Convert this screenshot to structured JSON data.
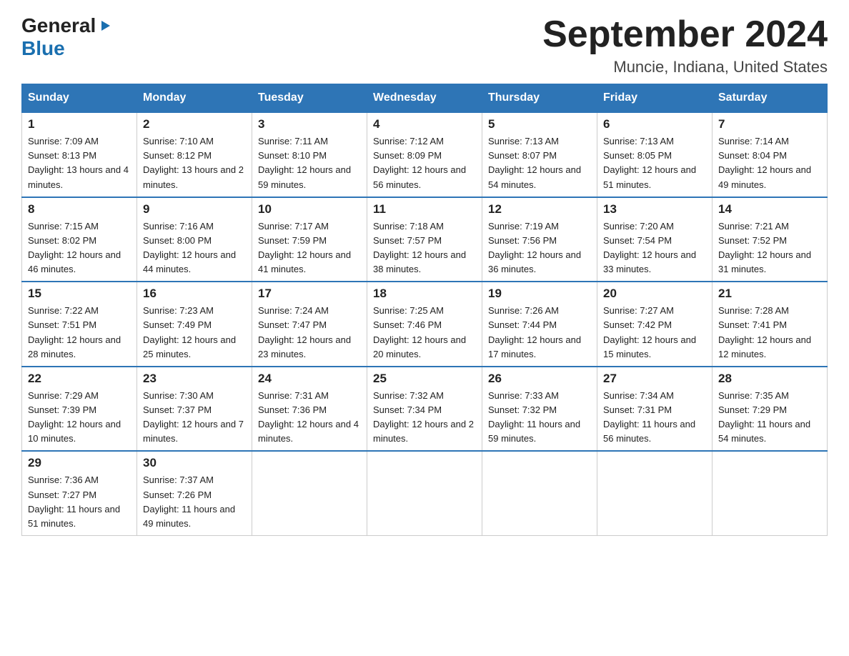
{
  "logo": {
    "general": "General",
    "blue": "Blue",
    "arrow": "▶"
  },
  "title": "September 2024",
  "subtitle": "Muncie, Indiana, United States",
  "days_of_week": [
    "Sunday",
    "Monday",
    "Tuesday",
    "Wednesday",
    "Thursday",
    "Friday",
    "Saturday"
  ],
  "weeks": [
    [
      {
        "day": "1",
        "sunrise": "Sunrise: 7:09 AM",
        "sunset": "Sunset: 8:13 PM",
        "daylight": "Daylight: 13 hours and 4 minutes."
      },
      {
        "day": "2",
        "sunrise": "Sunrise: 7:10 AM",
        "sunset": "Sunset: 8:12 PM",
        "daylight": "Daylight: 13 hours and 2 minutes."
      },
      {
        "day": "3",
        "sunrise": "Sunrise: 7:11 AM",
        "sunset": "Sunset: 8:10 PM",
        "daylight": "Daylight: 12 hours and 59 minutes."
      },
      {
        "day": "4",
        "sunrise": "Sunrise: 7:12 AM",
        "sunset": "Sunset: 8:09 PM",
        "daylight": "Daylight: 12 hours and 56 minutes."
      },
      {
        "day": "5",
        "sunrise": "Sunrise: 7:13 AM",
        "sunset": "Sunset: 8:07 PM",
        "daylight": "Daylight: 12 hours and 54 minutes."
      },
      {
        "day": "6",
        "sunrise": "Sunrise: 7:13 AM",
        "sunset": "Sunset: 8:05 PM",
        "daylight": "Daylight: 12 hours and 51 minutes."
      },
      {
        "day": "7",
        "sunrise": "Sunrise: 7:14 AM",
        "sunset": "Sunset: 8:04 PM",
        "daylight": "Daylight: 12 hours and 49 minutes."
      }
    ],
    [
      {
        "day": "8",
        "sunrise": "Sunrise: 7:15 AM",
        "sunset": "Sunset: 8:02 PM",
        "daylight": "Daylight: 12 hours and 46 minutes."
      },
      {
        "day": "9",
        "sunrise": "Sunrise: 7:16 AM",
        "sunset": "Sunset: 8:00 PM",
        "daylight": "Daylight: 12 hours and 44 minutes."
      },
      {
        "day": "10",
        "sunrise": "Sunrise: 7:17 AM",
        "sunset": "Sunset: 7:59 PM",
        "daylight": "Daylight: 12 hours and 41 minutes."
      },
      {
        "day": "11",
        "sunrise": "Sunrise: 7:18 AM",
        "sunset": "Sunset: 7:57 PM",
        "daylight": "Daylight: 12 hours and 38 minutes."
      },
      {
        "day": "12",
        "sunrise": "Sunrise: 7:19 AM",
        "sunset": "Sunset: 7:56 PM",
        "daylight": "Daylight: 12 hours and 36 minutes."
      },
      {
        "day": "13",
        "sunrise": "Sunrise: 7:20 AM",
        "sunset": "Sunset: 7:54 PM",
        "daylight": "Daylight: 12 hours and 33 minutes."
      },
      {
        "day": "14",
        "sunrise": "Sunrise: 7:21 AM",
        "sunset": "Sunset: 7:52 PM",
        "daylight": "Daylight: 12 hours and 31 minutes."
      }
    ],
    [
      {
        "day": "15",
        "sunrise": "Sunrise: 7:22 AM",
        "sunset": "Sunset: 7:51 PM",
        "daylight": "Daylight: 12 hours and 28 minutes."
      },
      {
        "day": "16",
        "sunrise": "Sunrise: 7:23 AM",
        "sunset": "Sunset: 7:49 PM",
        "daylight": "Daylight: 12 hours and 25 minutes."
      },
      {
        "day": "17",
        "sunrise": "Sunrise: 7:24 AM",
        "sunset": "Sunset: 7:47 PM",
        "daylight": "Daylight: 12 hours and 23 minutes."
      },
      {
        "day": "18",
        "sunrise": "Sunrise: 7:25 AM",
        "sunset": "Sunset: 7:46 PM",
        "daylight": "Daylight: 12 hours and 20 minutes."
      },
      {
        "day": "19",
        "sunrise": "Sunrise: 7:26 AM",
        "sunset": "Sunset: 7:44 PM",
        "daylight": "Daylight: 12 hours and 17 minutes."
      },
      {
        "day": "20",
        "sunrise": "Sunrise: 7:27 AM",
        "sunset": "Sunset: 7:42 PM",
        "daylight": "Daylight: 12 hours and 15 minutes."
      },
      {
        "day": "21",
        "sunrise": "Sunrise: 7:28 AM",
        "sunset": "Sunset: 7:41 PM",
        "daylight": "Daylight: 12 hours and 12 minutes."
      }
    ],
    [
      {
        "day": "22",
        "sunrise": "Sunrise: 7:29 AM",
        "sunset": "Sunset: 7:39 PM",
        "daylight": "Daylight: 12 hours and 10 minutes."
      },
      {
        "day": "23",
        "sunrise": "Sunrise: 7:30 AM",
        "sunset": "Sunset: 7:37 PM",
        "daylight": "Daylight: 12 hours and 7 minutes."
      },
      {
        "day": "24",
        "sunrise": "Sunrise: 7:31 AM",
        "sunset": "Sunset: 7:36 PM",
        "daylight": "Daylight: 12 hours and 4 minutes."
      },
      {
        "day": "25",
        "sunrise": "Sunrise: 7:32 AM",
        "sunset": "Sunset: 7:34 PM",
        "daylight": "Daylight: 12 hours and 2 minutes."
      },
      {
        "day": "26",
        "sunrise": "Sunrise: 7:33 AM",
        "sunset": "Sunset: 7:32 PM",
        "daylight": "Daylight: 11 hours and 59 minutes."
      },
      {
        "day": "27",
        "sunrise": "Sunrise: 7:34 AM",
        "sunset": "Sunset: 7:31 PM",
        "daylight": "Daylight: 11 hours and 56 minutes."
      },
      {
        "day": "28",
        "sunrise": "Sunrise: 7:35 AM",
        "sunset": "Sunset: 7:29 PM",
        "daylight": "Daylight: 11 hours and 54 minutes."
      }
    ],
    [
      {
        "day": "29",
        "sunrise": "Sunrise: 7:36 AM",
        "sunset": "Sunset: 7:27 PM",
        "daylight": "Daylight: 11 hours and 51 minutes."
      },
      {
        "day": "30",
        "sunrise": "Sunrise: 7:37 AM",
        "sunset": "Sunset: 7:26 PM",
        "daylight": "Daylight: 11 hours and 49 minutes."
      },
      null,
      null,
      null,
      null,
      null
    ]
  ]
}
